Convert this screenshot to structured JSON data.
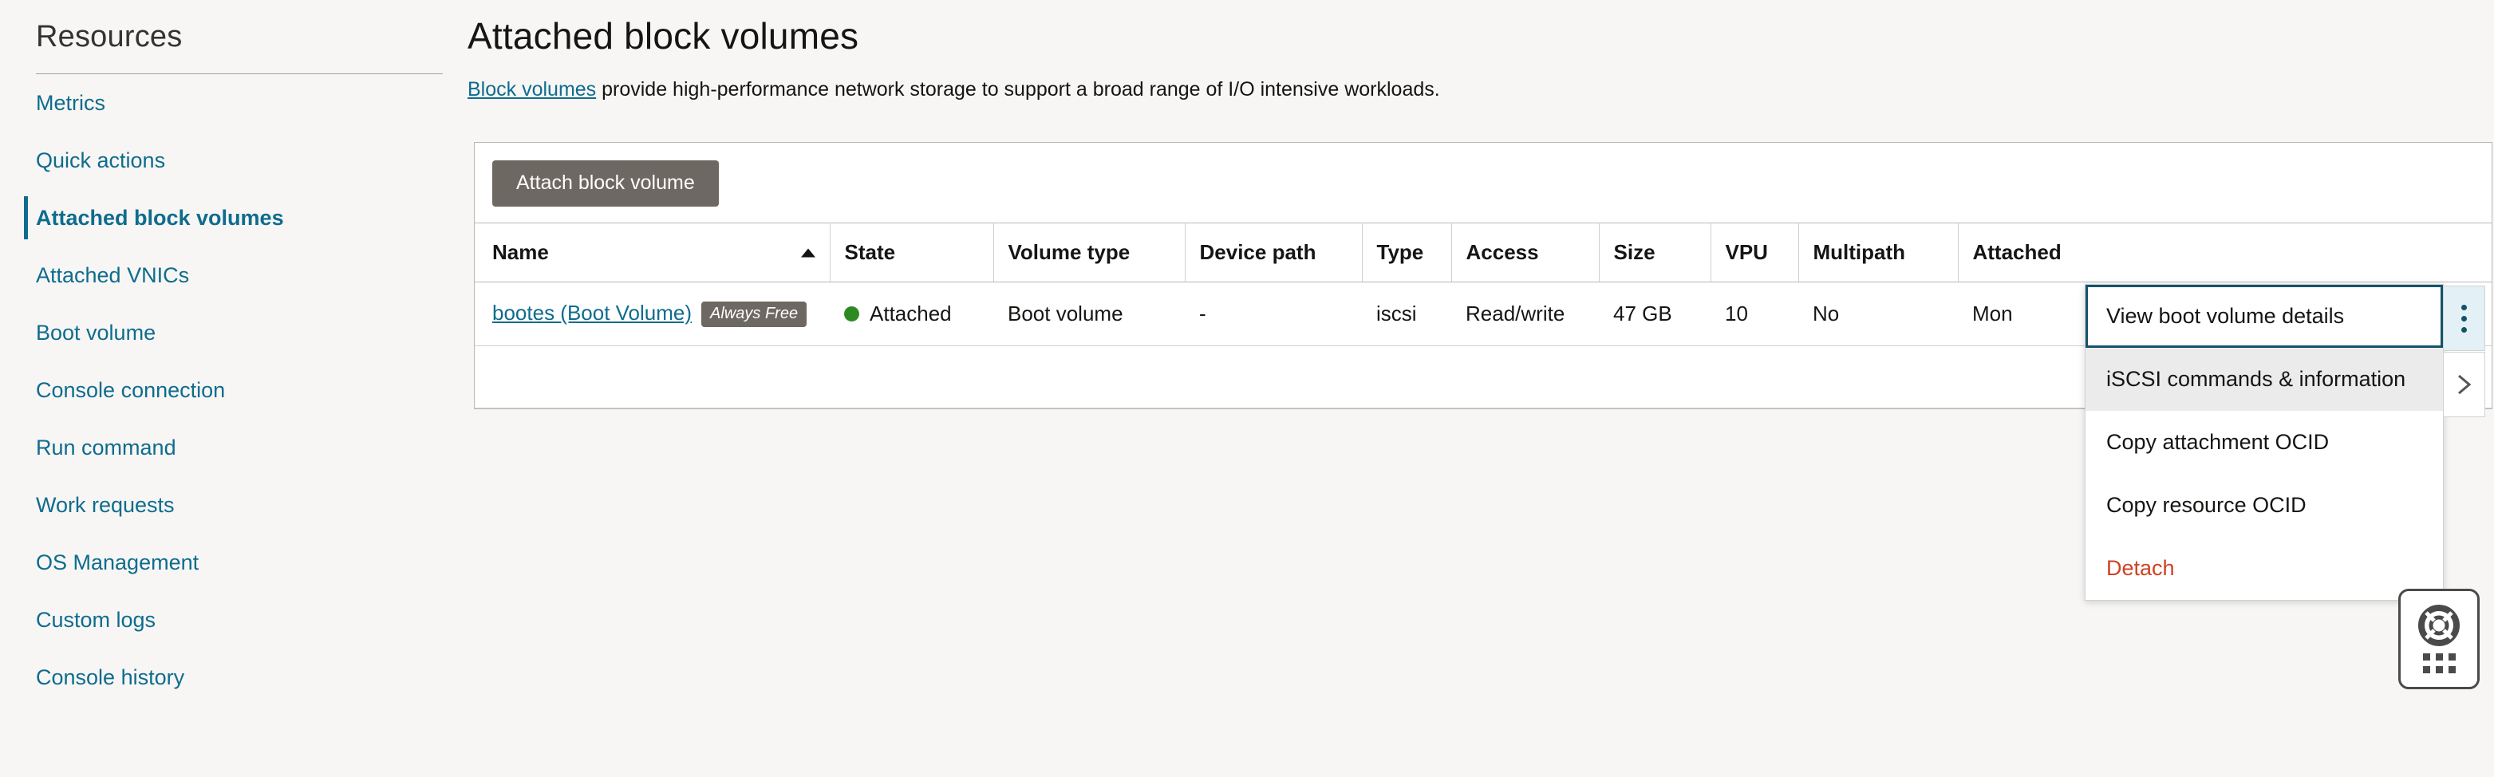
{
  "sidebar": {
    "title": "Resources",
    "items": [
      {
        "label": "Metrics",
        "active": false
      },
      {
        "label": "Quick actions",
        "active": false
      },
      {
        "label": "Attached block volumes",
        "active": true
      },
      {
        "label": "Attached VNICs",
        "active": false
      },
      {
        "label": "Boot volume",
        "active": false
      },
      {
        "label": "Console connection",
        "active": false
      },
      {
        "label": "Run command",
        "active": false
      },
      {
        "label": "Work requests",
        "active": false
      },
      {
        "label": "OS Management",
        "active": false
      },
      {
        "label": "Custom logs",
        "active": false
      },
      {
        "label": "Console history",
        "active": false
      }
    ]
  },
  "main": {
    "page_title": "Attached block volumes",
    "description_link": "Block volumes",
    "description_rest": " provide high-performance network storage to support a broad range of I/O intensive workloads.",
    "toolbar": {
      "attach_button": "Attach block volume"
    }
  },
  "table": {
    "columns": [
      "Name",
      "State",
      "Volume type",
      "Device path",
      "Type",
      "Access",
      "Size",
      "VPU",
      "Multipath",
      "Attached"
    ],
    "sort": {
      "column": "Name",
      "direction": "asc",
      "icon": "sort-ascending-icon"
    },
    "rows": [
      {
        "name": "bootes (Boot Volume)",
        "badge": "Always Free",
        "state": "Attached",
        "state_color": "#2d8a23",
        "volume_type": "Boot volume",
        "device_path": "-",
        "type": "iscsi",
        "access": "Read/write",
        "size": "47 GB",
        "vpu": "10",
        "multipath": "No",
        "attached": "Mon"
      }
    ]
  },
  "context_menu": {
    "items": [
      {
        "label": "View boot volume details",
        "state": "focused"
      },
      {
        "label": "iSCSI commands & information",
        "state": "hovered",
        "has_submenu": true
      },
      {
        "label": "Copy attachment OCID",
        "state": "normal"
      },
      {
        "label": "Copy resource OCID",
        "state": "normal"
      },
      {
        "label": "Detach",
        "state": "danger"
      }
    ]
  },
  "row_actions": {
    "kebab": "kebab-menu-icon",
    "submenu": "chevron-right-icon"
  },
  "help_widget": {
    "icon": "life-ring-icon",
    "grid": "app-grid-icon"
  },
  "colors": {
    "link": "#0e6c8e",
    "accent": "#12536b",
    "danger": "#cf4223",
    "status_green": "#2d8a23",
    "button_bg": "#6e6862",
    "page_bg": "#f7f6f4"
  }
}
